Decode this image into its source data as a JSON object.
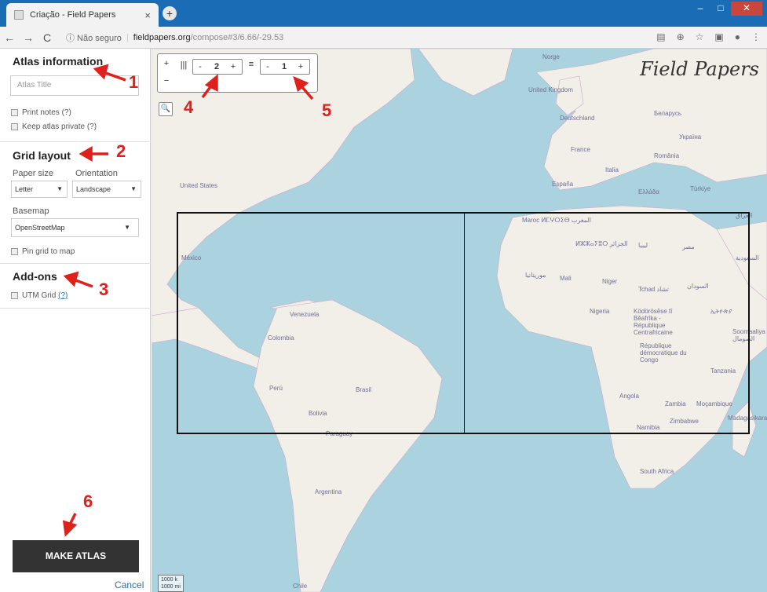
{
  "browser": {
    "tab_title": "Criação - Field Papers",
    "tab_close": "×",
    "new_tab": "+",
    "back": "←",
    "forward": "→",
    "reload": "C",
    "security": "ⓘ Não seguro",
    "url_host": "fieldpapers.org",
    "url_path": "/compose#3/6.66/-29.53"
  },
  "sidebar": {
    "atlas_heading": "Atlas information",
    "atlas_title_placeholder": "Atlas Title",
    "print_notes": "Print notes",
    "print_notes_help": "(?)",
    "keep_private": "Keep atlas private",
    "keep_private_help": "(?)",
    "grid_heading": "Grid layout",
    "paper_size_label": "Paper size",
    "paper_size_value": "Letter",
    "orientation_label": "Orientation",
    "orientation_value": "Landscape",
    "basemap_label": "Basemap",
    "basemap_value": "OpenStreetMap",
    "pin_grid": "Pin grid to map",
    "addons_heading": "Add-ons",
    "utm_grid": "UTM Grid",
    "utm_help": "(?)",
    "make_atlas": "MAKE ATLAS",
    "cancel": "Cancel"
  },
  "map": {
    "brand": "Field Papers",
    "zoom_in": "+",
    "zoom_out": "−",
    "cols_icon": "|||",
    "cols_minus": "-",
    "cols_value": "2",
    "cols_plus": "+",
    "rows_icon": "≡",
    "rows_minus": "-",
    "rows_value": "1",
    "rows_plus": "+",
    "search_icon": "🔍",
    "scale_top": "1000 k",
    "scale_bottom": "1000 mi",
    "labels": {
      "norge": "Norge",
      "uk": "United Kingdom",
      "deutschland": "Deutschland",
      "belarus": "Беларусь",
      "ukraine": "Україна",
      "france": "France",
      "romania": "România",
      "italia": "Italia",
      "espana": "España",
      "turkiye": "Türkiye",
      "greece": "Ελλάδα",
      "usa": "United States",
      "iraq": "العراق",
      "morocco": "Maroc ⵍⵎⵖⵔⵉⴱ المغرب",
      "algeria": "ⵍⵣⵣⴰⵢⴻⵔ الجزائر",
      "libya": "ليبيا",
      "egypt": "مصر",
      "saudi": "السعودية",
      "mexico": "México",
      "mauritania": "موريتانيا",
      "mali": "Mali",
      "niger": "Niger",
      "chad": "Tchad تشاد",
      "sudan": "السودان",
      "nigeria": "Nigeria",
      "car": "Ködörösêse tî Bêafrîka - République Centrafricaine",
      "ethiopia": "ኢትዮጵያ",
      "somalia": "Soomaaliya الصومال",
      "drc": "République démocratique du Congo",
      "tanzania": "Tanzania",
      "venezuela": "Venezuela",
      "colombia": "Colombia",
      "peru": "Perú",
      "brasil": "Brasil",
      "bolivia": "Bolivia",
      "paraguay": "Paraguay",
      "angola": "Angola",
      "zambia": "Zambia",
      "mozambique": "Moçambique",
      "madagascar": "Madagasikara",
      "namibia": "Namibia",
      "zimbabwe": "Zimbabwe",
      "south_africa": "South Africa",
      "argentina": "Argentina",
      "chile": "Chile"
    }
  },
  "annotations": [
    "1",
    "2",
    "3",
    "4",
    "5",
    "6"
  ]
}
